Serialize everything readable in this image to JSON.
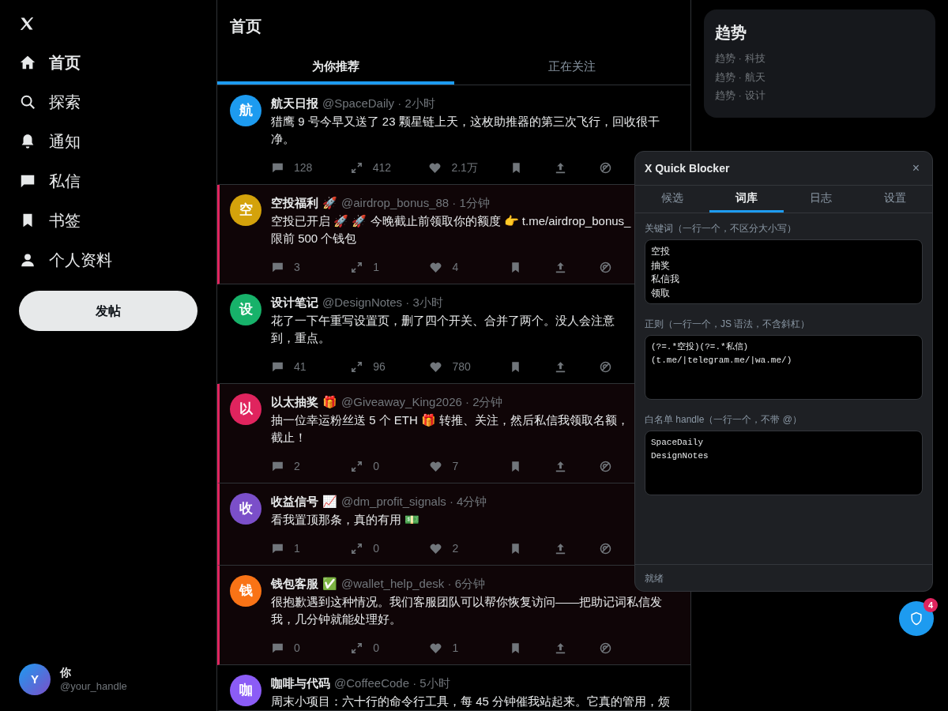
{
  "sidebar": {
    "nav": [
      {
        "label": "首页",
        "selected": true
      },
      {
        "label": "探索",
        "selected": false
      },
      {
        "label": "通知",
        "selected": false
      },
      {
        "label": "私信",
        "selected": false
      },
      {
        "label": "书签",
        "selected": false
      },
      {
        "label": "个人资料",
        "selected": false
      }
    ],
    "post_button": "发帖",
    "user": {
      "avatar": "Y",
      "name": "你",
      "handle": "@your_handle"
    }
  },
  "feed": {
    "title": "首页",
    "tabs": [
      {
        "label": "为你推荐",
        "selected": true
      },
      {
        "label": "正在关注",
        "selected": false
      }
    ],
    "tweets": [
      {
        "avatar": "航",
        "color": "#1d9bf0",
        "name": "航天日报",
        "meta": "@SpaceDaily · 2小时",
        "text": "猎鹰 9 号今早又送了 23 颗星链上天，这枚助推器的第三次飞行，回收很干净。",
        "replies": "128",
        "retweets": "412",
        "likes": "2.1万",
        "flagged": false
      },
      {
        "avatar": "空",
        "color": "#d4a20b",
        "name": "空投福利",
        "emoji": "🚀",
        "meta": "@airdrop_bonus_88 · 1分钟",
        "text": "空投已开启 🚀 🚀 今晚截止前领取你的额度 👉 t.me/airdrop_bonus_限前 500 个钱包",
        "replies": "3",
        "retweets": "1",
        "likes": "4",
        "flagged": true
      },
      {
        "avatar": "设",
        "color": "#17b26a",
        "name": "设计笔记",
        "meta": "@DesignNotes · 3小时",
        "text": "花了一下午重写设置页，删了四个开关、合并了两个。没人会注意到，重点。",
        "replies": "41",
        "retweets": "96",
        "likes": "780",
        "flagged": false
      },
      {
        "avatar": "以",
        "color": "#e0245e",
        "name": "以太抽奖",
        "emoji": "🎁",
        "meta": "@Giveaway_King2026 · 2分钟",
        "text": "抽一位幸运粉丝送 5 个 ETH 🎁 转推、关注，然后私信我领取名额，截止！",
        "replies": "2",
        "retweets": "0",
        "likes": "7",
        "flagged": true
      },
      {
        "avatar": "收",
        "color": "#7b4fc9",
        "name": "收益信号",
        "emoji": "📈",
        "meta": "@dm_profit_signals · 4分钟",
        "text": "看我置顶那条，真的有用 💵",
        "replies": "1",
        "retweets": "0",
        "likes": "2",
        "flagged": true
      },
      {
        "avatar": "钱",
        "color": "#f97316",
        "name": "钱包客服",
        "emoji": "✅",
        "meta": "@wallet_help_desk · 6分钟",
        "text": "很抱歉遇到这种情况。我们客服团队可以帮你恢复访问——把助记词私信发我，几分钟就能处理好。",
        "replies": "0",
        "retweets": "0",
        "likes": "1",
        "flagged": true
      },
      {
        "avatar": "咖",
        "color": "#8b5cf6",
        "name": "咖啡与代码",
        "meta": "@CoffeeCode · 5小时",
        "text": "周末小项目：六十行的命令行工具，每 45 分钟催我站起来。它真的管用，烦",
        "flagged": false
      }
    ]
  },
  "trends": {
    "title": "趋势",
    "items": [
      "趋势 · 科技",
      "趋势 · 航天",
      "趋势 · 设计"
    ]
  },
  "blocker": {
    "title": "X Quick Blocker",
    "close": "×",
    "tabs": [
      {
        "label": "候选",
        "selected": false
      },
      {
        "label": "词库",
        "selected": true
      },
      {
        "label": "日志",
        "selected": false
      },
      {
        "label": "设置",
        "selected": false
      }
    ],
    "fields": [
      {
        "label": "关键词（一行一个，不区分大小写）",
        "lines": [
          "空投",
          "抽奖",
          "私信我",
          "领取"
        ]
      },
      {
        "label": "正则（一行一个，JS 语法，不含斜杠）",
        "lines": [
          "(?=.*空投)(?=.*私信)",
          "(t.me/|telegram.me/|wa.me/)"
        ]
      },
      {
        "label": "白名单 handle（一行一个，不带 @）",
        "lines": [
          "SpaceDaily",
          "DesignNotes"
        ]
      }
    ],
    "status": "就绪"
  },
  "fab": {
    "badge": "4"
  }
}
